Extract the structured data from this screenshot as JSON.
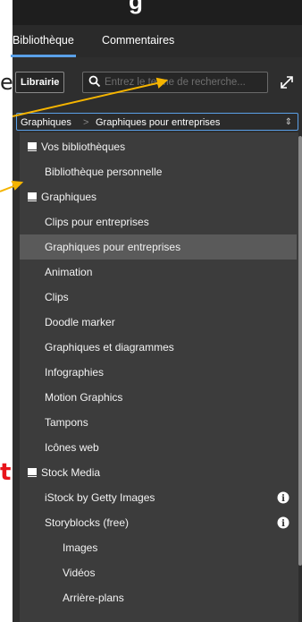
{
  "tabs": [
    {
      "label": "Bibliothèque",
      "active": true
    },
    {
      "label": "Commentaires",
      "active": false
    }
  ],
  "toolbar": {
    "library_button": "Librairie",
    "search_placeholder": "Entrez le terme de recherche..."
  },
  "breadcrumb": {
    "root": "Graphiques",
    "separator": ">",
    "current": "Graphiques pour entreprises"
  },
  "list": {
    "items": [
      {
        "label": "Vos bibliothèques",
        "icon": "book-icon"
      },
      {
        "label": "Bibliothèque personnelle"
      },
      {
        "label": "Graphiques",
        "icon": "book-icon"
      },
      {
        "label": "Clips pour entreprises"
      },
      {
        "label": "Graphiques pour entreprises",
        "selected": true
      },
      {
        "label": "Animation"
      },
      {
        "label": "Clips"
      },
      {
        "label": "Doodle marker"
      },
      {
        "label": "Graphiques et diagrammes"
      },
      {
        "label": "Infographies"
      },
      {
        "label": "Motion Graphics"
      },
      {
        "label": "Tampons"
      },
      {
        "label": "Icônes web"
      },
      {
        "label": "Stock Media",
        "icon": "book-icon"
      },
      {
        "label": "iStock by Getty Images",
        "info": true
      },
      {
        "label": "Storyblocks (free)",
        "info": true
      },
      {
        "label": "Images"
      },
      {
        "label": "Vidéos"
      },
      {
        "label": "Arrière-plans"
      }
    ]
  },
  "annotations": {
    "left_char_1": "e",
    "left_char_2": "t",
    "top_fragment": "g"
  },
  "colors": {
    "accent": "#5aa0e8",
    "arrow": "#f5b400",
    "panel_bg": "#2e2e2e",
    "list_bg": "#3c3c3c",
    "selected_bg": "#5a5a5a"
  }
}
